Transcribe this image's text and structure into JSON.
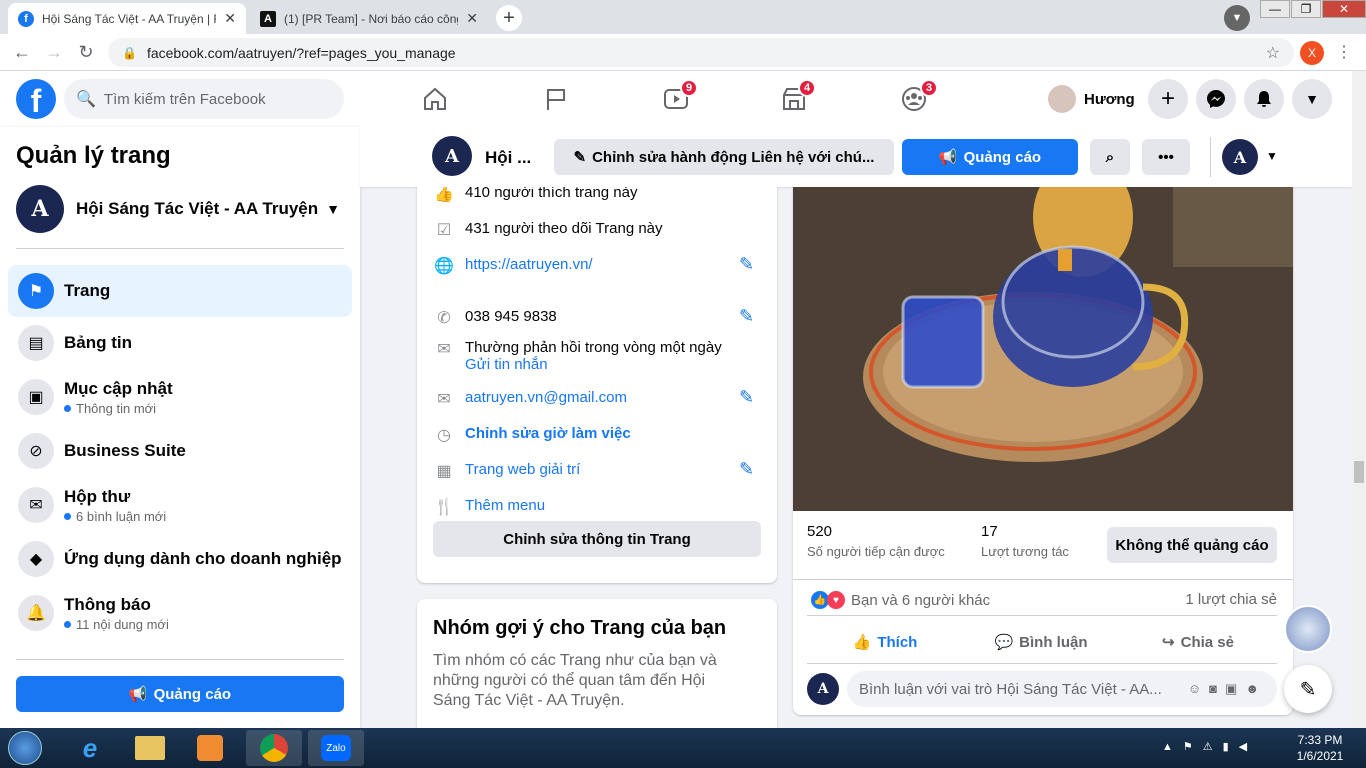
{
  "browser": {
    "tabs": [
      {
        "title": "Hội Sáng Tác Việt - AA Truyện | F",
        "active": true
      },
      {
        "title": "(1) [PR Team] - Nơi báo cáo công",
        "active": false
      }
    ],
    "url": "facebook.com/aatruyen/?ref=pages_you_manage",
    "profile_initial": "X"
  },
  "fb_nav": {
    "search_placeholder": "Tìm kiếm trên Facebook",
    "badges": {
      "watch": "9",
      "marketplace": "4",
      "groups": "3"
    },
    "user_name": "Hương"
  },
  "sidebar": {
    "title": "Quản lý trang",
    "page_name": "Hội Sáng Tác Việt - AA Truyện",
    "items": [
      {
        "label": "Trang",
        "sub": ""
      },
      {
        "label": "Bảng tin",
        "sub": ""
      },
      {
        "label": "Mục cập nhật",
        "sub": "Thông tin mới"
      },
      {
        "label": "Business Suite",
        "sub": ""
      },
      {
        "label": "Hộp thư",
        "sub": "6 bình luận mới"
      },
      {
        "label": "Ứng dụng dành cho doanh nghiệp",
        "sub": ""
      },
      {
        "label": "Thông báo",
        "sub": "11 nội dung mới"
      }
    ],
    "ads_button": "Quảng cáo"
  },
  "page_header": {
    "page_short": "Hội ...",
    "edit_action": "Chỉnh sửa hành động Liên hệ với chú...",
    "ads_button": "Quảng cáo"
  },
  "about": {
    "likes": "410 người thích trang này",
    "follows": "431 người theo dõi Trang này",
    "website": "https://aatruyen.vn/",
    "phone": "038 945 9838",
    "response": "Thường phản hồi trong vòng một ngày",
    "send_message": "Gửi tin nhắn",
    "email": "aatruyen.vn@gmail.com",
    "hours": "Chỉnh sửa giờ làm việc",
    "category": "Trang web giải trí",
    "menu": "Thêm menu",
    "edit_button": "Chỉnh sửa thông tin Trang"
  },
  "groups_card": {
    "title": "Nhóm gợi ý cho Trang của bạn",
    "desc": "Tìm nhóm có các Trang như của bạn và những người có thể quan tâm đến Hội Sáng Tác Việt - AA Truyện."
  },
  "post": {
    "reach_value": "520",
    "reach_label": "Số người tiếp cận được",
    "engage_value": "17",
    "engage_label": "Lượt tương tác",
    "no_ads": "Không thể quảng cáo",
    "reactions": "Bạn và 6 người khác",
    "shares": "1 lượt chia sẻ",
    "like": "Thích",
    "comment": "Bình luận",
    "share": "Chia sẻ",
    "comment_placeholder": "Bình luận với vai trò Hội Sáng Tác Việt - AA..."
  },
  "taskbar": {
    "time": "7:33 PM",
    "date": "1/6/2021"
  }
}
